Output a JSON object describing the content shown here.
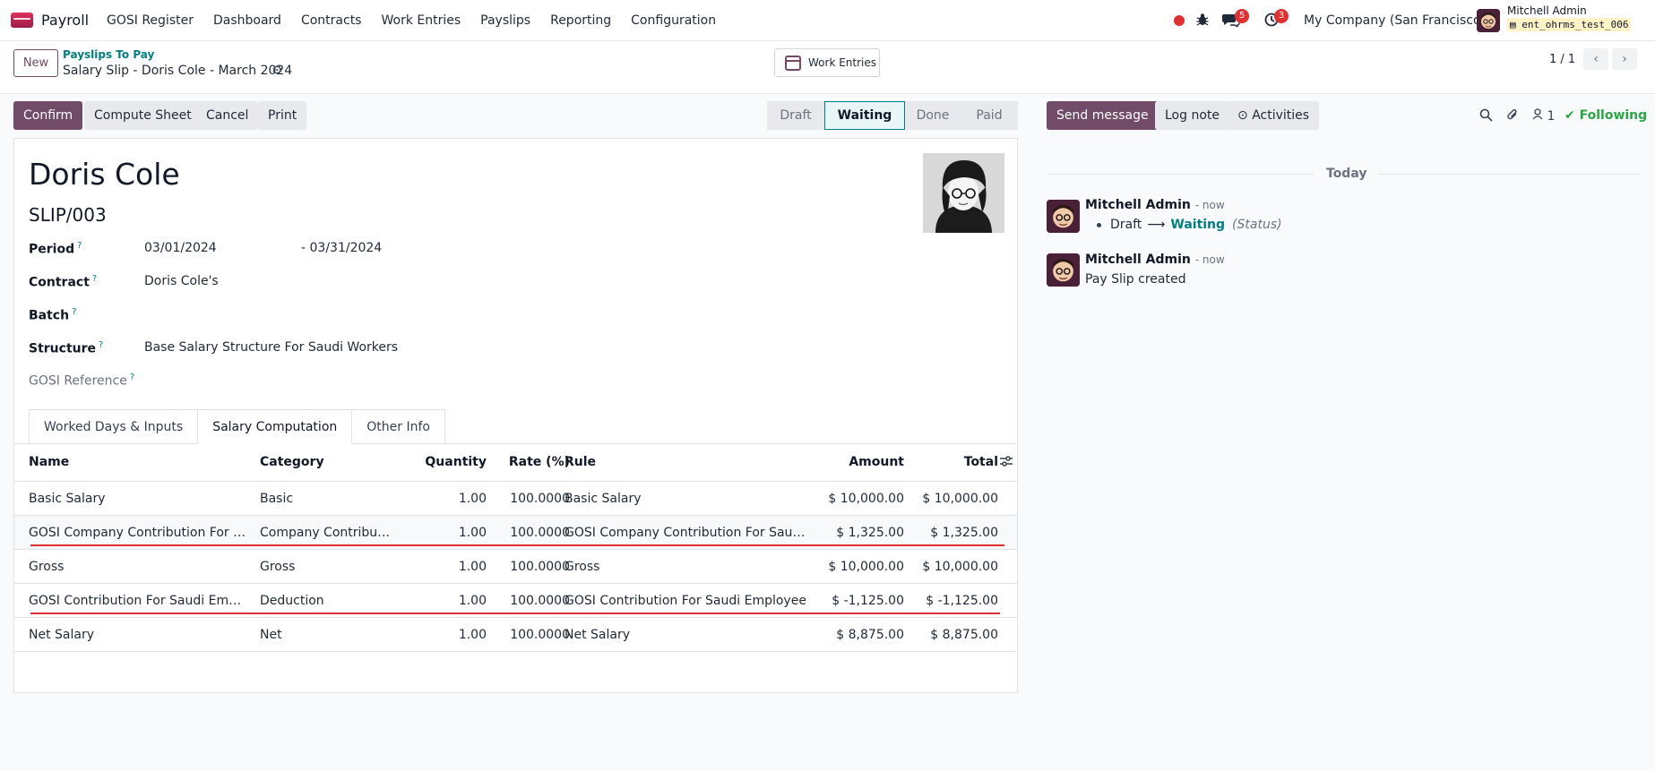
{
  "navbar": {
    "app_name": "Payroll",
    "menu": [
      "GOSI Register",
      "Dashboard",
      "Contracts",
      "Work Entries",
      "Payslips",
      "Reporting",
      "Configuration"
    ],
    "messages_badge": "5",
    "activities_badge": "3",
    "company": "My Company (San Francisco)",
    "user_name": "Mitchell Admin",
    "database": "ent_ohrms_test_006"
  },
  "control": {
    "new_label": "New",
    "breadcrumb_parent": "Payslips To Pay",
    "breadcrumb_current": "Salary Slip - Doris Cole - March 2024",
    "work_entries_label": "Work Entries",
    "pager": "1 / 1"
  },
  "actions": {
    "confirm": "Confirm",
    "compute_sheet": "Compute Sheet",
    "cancel": "Cancel",
    "print": "Print"
  },
  "status": {
    "stages": [
      "Draft",
      "Waiting",
      "Done",
      "Paid"
    ],
    "current": "Waiting"
  },
  "form": {
    "employee_name": "Doris Cole",
    "slip_number": "SLIP/003",
    "labels": {
      "period": "Period",
      "contract": "Contract",
      "batch": "Batch",
      "structure": "Structure",
      "gosi_reference": "GOSI Reference"
    },
    "help_marker": "?",
    "period_from": "03/01/2024",
    "period_to": "- 03/31/2024",
    "contract": "Doris Cole's",
    "batch": "",
    "structure": "Base Salary Structure For Saudi Workers",
    "gosi_reference": ""
  },
  "tabs": [
    "Worked Days & Inputs",
    "Salary Computation",
    "Other Info"
  ],
  "table": {
    "headers": {
      "name": "Name",
      "category": "Category",
      "quantity": "Quantity",
      "rate": "Rate (%)",
      "rule": "Rule",
      "amount": "Amount",
      "total": "Total"
    },
    "rows": [
      {
        "name": "Basic Salary",
        "category": "Basic",
        "quantity": "1.00",
        "rate": "100.0000",
        "rule": "Basic Salary",
        "amount": "$ 10,000.00",
        "total": "$ 10,000.00"
      },
      {
        "name": "GOSI Company Contribution For Sau...",
        "category": "Company Contribution",
        "quantity": "1.00",
        "rate": "100.0000",
        "rule": "GOSI Company Contribution For Saudi ...",
        "amount": "$ 1,325.00",
        "total": "$ 1,325.00"
      },
      {
        "name": "Gross",
        "category": "Gross",
        "quantity": "1.00",
        "rate": "100.0000",
        "rule": "Gross",
        "amount": "$ 10,000.00",
        "total": "$ 10,000.00"
      },
      {
        "name": "GOSI Contribution For Saudi Employee",
        "category": "Deduction",
        "quantity": "1.00",
        "rate": "100.0000",
        "rule": "GOSI Contribution For Saudi Employee",
        "amount": "$ -1,125.00",
        "total": "$ -1,125.00"
      },
      {
        "name": "Net Salary",
        "category": "Net",
        "quantity": "1.00",
        "rate": "100.0000",
        "rule": "Net Salary",
        "amount": "$ 8,875.00",
        "total": "$ 8,875.00"
      }
    ]
  },
  "chatter": {
    "send_message": "Send message",
    "log_note": "Log note",
    "activities": "Activities",
    "followers_count": "1",
    "following": "Following",
    "date_separator": "Today",
    "messages": [
      {
        "author": "Mitchell Admin",
        "time": "- now",
        "tracking_old": "Draft",
        "tracking_new": "Waiting",
        "tracking_field": "(Status)"
      },
      {
        "author": "Mitchell Admin",
        "time": "- now",
        "body": "Pay Slip created"
      }
    ]
  },
  "colors": {
    "brand": "#714b67",
    "link": "#017e84",
    "badge": "#e03131",
    "following": "#28a745",
    "annotation_underline": "#e03131"
  }
}
